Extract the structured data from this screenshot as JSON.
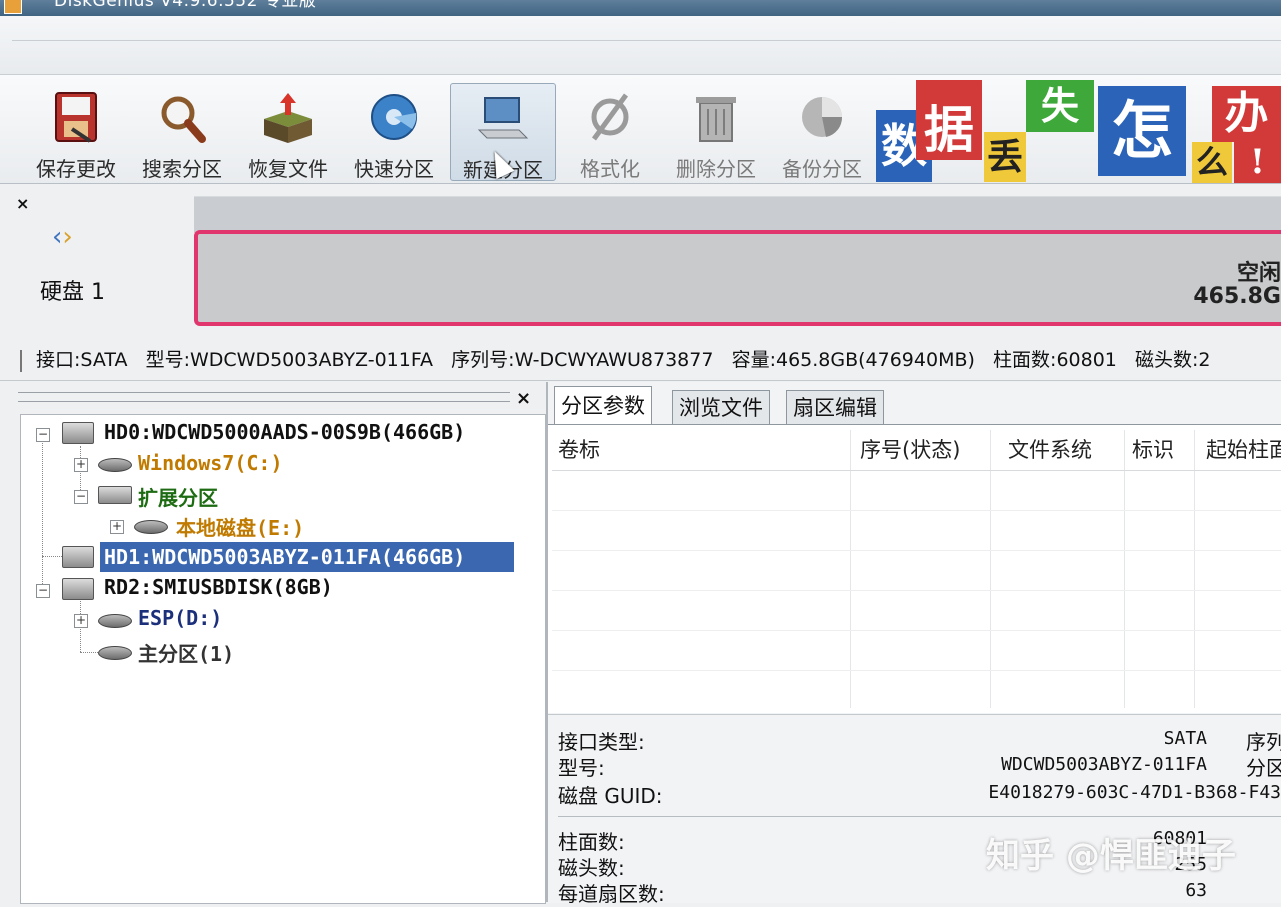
{
  "window": {
    "title": "DiskGenius V4.9.6.552 专业版"
  },
  "toolbar": {
    "buttons": [
      {
        "label": "保存更改",
        "icon": "save-icon"
      },
      {
        "label": "搜索分区",
        "icon": "magnifier-icon"
      },
      {
        "label": "恢复文件",
        "icon": "recover-box-icon"
      },
      {
        "label": "快速分区",
        "icon": "quick-partition-disc-icon"
      },
      {
        "label": "新建分区",
        "icon": "new-partition-laptop-icon",
        "active": true
      },
      {
        "label": "格式化",
        "icon": "format-icon"
      },
      {
        "label": "删除分区",
        "icon": "trash-icon"
      },
      {
        "label": "备份分区",
        "icon": "backup-pie-icon"
      }
    ]
  },
  "banner": {
    "chars": [
      "数",
      "据",
      "丢",
      "失",
      "怎",
      "么",
      "办",
      "!"
    ]
  },
  "disk_map": {
    "disk_label": "硬盘 1",
    "free_label": "空闲",
    "free_size": "465.8G",
    "info": {
      "interface": "接口:SATA",
      "model": "型号:WDCWD5003ABYZ-011FA",
      "serial": "序列号:W-DCWYAWU873877",
      "capacity": "容量:465.8GB(476940MB)",
      "cylinders": "柱面数:60801",
      "heads": "磁头数:2"
    }
  },
  "tree": {
    "hd0": "HD0:WDCWD5000AADS-00S9B(466GB)",
    "windows7": "Windows7(C:)",
    "extended": "扩展分区",
    "local_disk": "本地磁盘(E:)",
    "hd1": "HD1:WDCWD5003ABYZ-011FA(466GB)",
    "rd2": "RD2:SMIUSBDISK(8GB)",
    "esp": "ESP(D:)",
    "primary": "主分区(1)"
  },
  "tabs": [
    "分区参数",
    "浏览文件",
    "扇区编辑"
  ],
  "columns": [
    "卷标",
    "序号(状态)",
    "文件系统",
    "标识",
    "起始柱面"
  ],
  "properties": {
    "interface_type": {
      "label": "接口类型:",
      "value": "SATA"
    },
    "model": {
      "label": "型号:",
      "value": "WDCWD5003ABYZ-011FA"
    },
    "guid": {
      "label": "磁盘 GUID:",
      "value": "E4018279-603C-47D1-B368-F43"
    },
    "right_labels": [
      "序列",
      "分区"
    ],
    "cylinders": {
      "label": "柱面数:",
      "value": "60801"
    },
    "heads": {
      "label": "磁头数:",
      "value": "255"
    },
    "sectors": {
      "label": "每道扇区数:",
      "value": "63"
    }
  },
  "watermark": "知乎 @悍匪迪子",
  "colors": {
    "highlight": "#3a67b0",
    "partition_border": "#e0356d",
    "ext_green": "#1d6b12",
    "win_orange": "#c07a00"
  }
}
